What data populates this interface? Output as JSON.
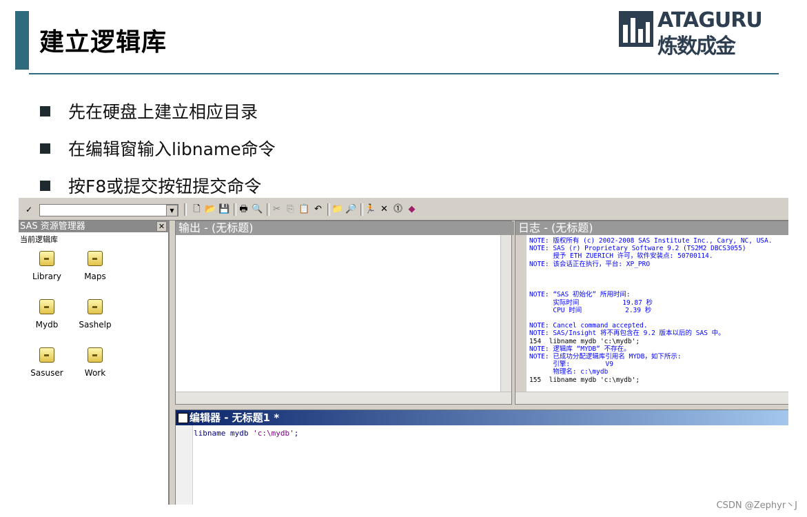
{
  "slide": {
    "title": "建立逻辑库",
    "logo_top": "ATAGURU",
    "logo_bottom": "炼数成金",
    "bullets": [
      "先在硬盘上建立相应目录",
      "在编辑窗输入libname命令",
      "按F8或提交按钮提交命令"
    ]
  },
  "sas": {
    "command_value": "",
    "explorer": {
      "title": "SAS 资源管理器",
      "subtitle": "当前逻辑库",
      "libraries": [
        "Library",
        "Maps",
        "Mydb",
        "Sashelp",
        "Sasuser",
        "Work"
      ]
    },
    "output_title": "输出 - (无标题)",
    "log": {
      "title": "日志 - (无标题)",
      "lines": [
        "NOTE: 版权所有 (c) 2002-2008 SAS Institute Inc., Cary, NC, USA.",
        "NOTE: SAS (r) Proprietary Software 9.2 (TS2M2 DBCS3055)",
        "      授予 ETH ZUERICH 许可，软件安装点: 50700114.",
        "NOTE: 该会话正在执行，平台: XP_PRO",
        "",
        "",
        "",
        "NOTE: “SAS 初始化” 所用时间:",
        "      实际时间           19.87 秒",
        "      CPU 时间           2.39 秒",
        "",
        "NOTE: Cancel command accepted.",
        "NOTE: SAS/Insight 将不再包含在 9.2 版本以后的 SAS 中。",
        "154  libname mydb 'c:\\mydb';",
        "NOTE: 逻辑库 “MYDB” 不存在。",
        "NOTE: 已成功分配逻辑库引用名 MYDB，如下所示:",
        "      引擎:         V9",
        "      物理名: c:\\mydb",
        "155  libname mydb 'c:\\mydb';"
      ]
    },
    "editor": {
      "title": "编辑器 - 无标题1 *",
      "code_kw": "libname mydb ",
      "code_str": "'c:\\mydb'",
      "code_end": ";"
    }
  },
  "watermark": "CSDN @Zephyr丶J"
}
